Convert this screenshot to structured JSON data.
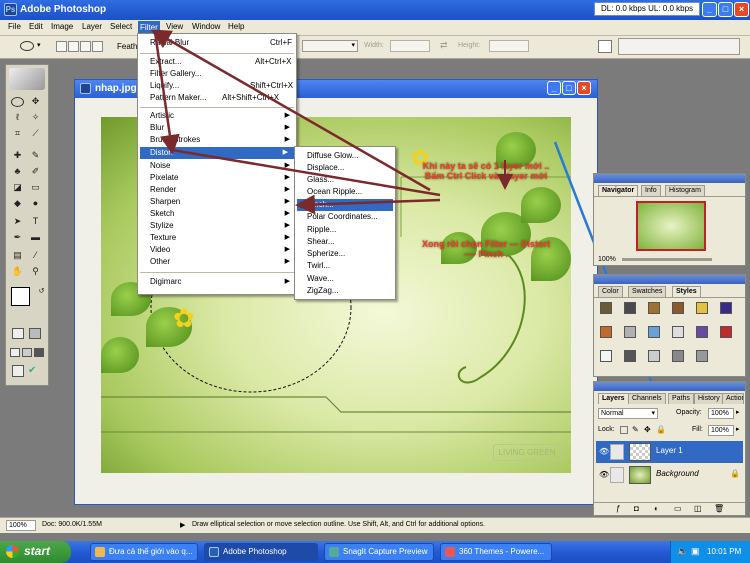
{
  "app": {
    "title": "Adobe Photoshop",
    "stats": "DL: 0.0 kbps  UL: 0.0 kbps",
    "min_glyph": "_",
    "max_glyph": "□",
    "close_glyph": "×"
  },
  "menubar": [
    "File",
    "Edit",
    "Image",
    "Layer",
    "Select",
    "Filter",
    "View",
    "Window",
    "Help"
  ],
  "options": {
    "feather_label": "Feath",
    "width_label": "Width:",
    "height_label": "Height:"
  },
  "document": {
    "title": "nhap.jpg",
    "logo_text": "LIVING GREEN",
    "min_glyph": "_",
    "max_glyph": "□",
    "close_glyph": "×"
  },
  "filter_menu": {
    "top_items": [
      {
        "label": "Radial Blur",
        "shortcut": "Ctrl+F"
      }
    ],
    "mid_items": [
      {
        "label": "Extract...",
        "shortcut": "Alt+Ctrl+X"
      },
      {
        "label": "Filter Gallery...",
        "shortcut": ""
      },
      {
        "label": "Liquify...",
        "shortcut": "Shift+Ctrl+X"
      },
      {
        "label": "Pattern Maker...",
        "shortcut": "Alt+Shift+Ctrl+X"
      }
    ],
    "sub_items": [
      "Artistic",
      "Blur",
      "Brush Strokes",
      "Distort",
      "Noise",
      "Pixelate",
      "Render",
      "Sharpen",
      "Sketch",
      "Stylize",
      "Texture",
      "Video",
      "Other"
    ],
    "bottom_items": [
      "Digimarc"
    ]
  },
  "distort_submenu": [
    "Diffuse Glow...",
    "Displace...",
    "Glass...",
    "Ocean Ripple...",
    "Pinch...",
    "Polar Coordinates...",
    "Ripple...",
    "Shear...",
    "Spherize...",
    "Twirl...",
    "Wave...",
    "ZigZag..."
  ],
  "annotations": {
    "note1_line1": "Khi này ta sẽ có 1 layer mới ..",
    "note1_line2": "Bấm Ctrl Click vào layer mới",
    "note2_line1": "Xong rồi chọn Filter ---  Distort",
    "note2_line2": "---- Pinch ."
  },
  "navigator": {
    "tabs": [
      "Navigator",
      "Info",
      "Histogram"
    ],
    "zoom": "100%"
  },
  "styles_palette": {
    "tabs": [
      "Color",
      "Swatches",
      "Styles"
    ]
  },
  "layers_palette": {
    "tabs": [
      "Layers",
      "Channels",
      "Paths",
      "History",
      "Actions"
    ],
    "blend_mode": "Normal",
    "opacity_label": "Opacity:",
    "opacity_value": "100%",
    "lock_label": "Lock:",
    "fill_label": "Fill:",
    "fill_value": "100%",
    "layers": [
      {
        "name": "Layer 1"
      },
      {
        "name": "Background"
      }
    ]
  },
  "statusbar": {
    "zoom": "100%",
    "doc": "Doc: 900.0K/1.55M",
    "hint": "Draw elliptical selection or move selection outline.  Use Shift, Alt, and Ctrl for additional options."
  },
  "taskbar": {
    "start": "start",
    "items": [
      "Đưa cả thế giới vào q...",
      "Adobe Photoshop",
      "SnagIt Capture Preview",
      "360 Themes - Powere..."
    ],
    "clock": "10:01 PM"
  }
}
